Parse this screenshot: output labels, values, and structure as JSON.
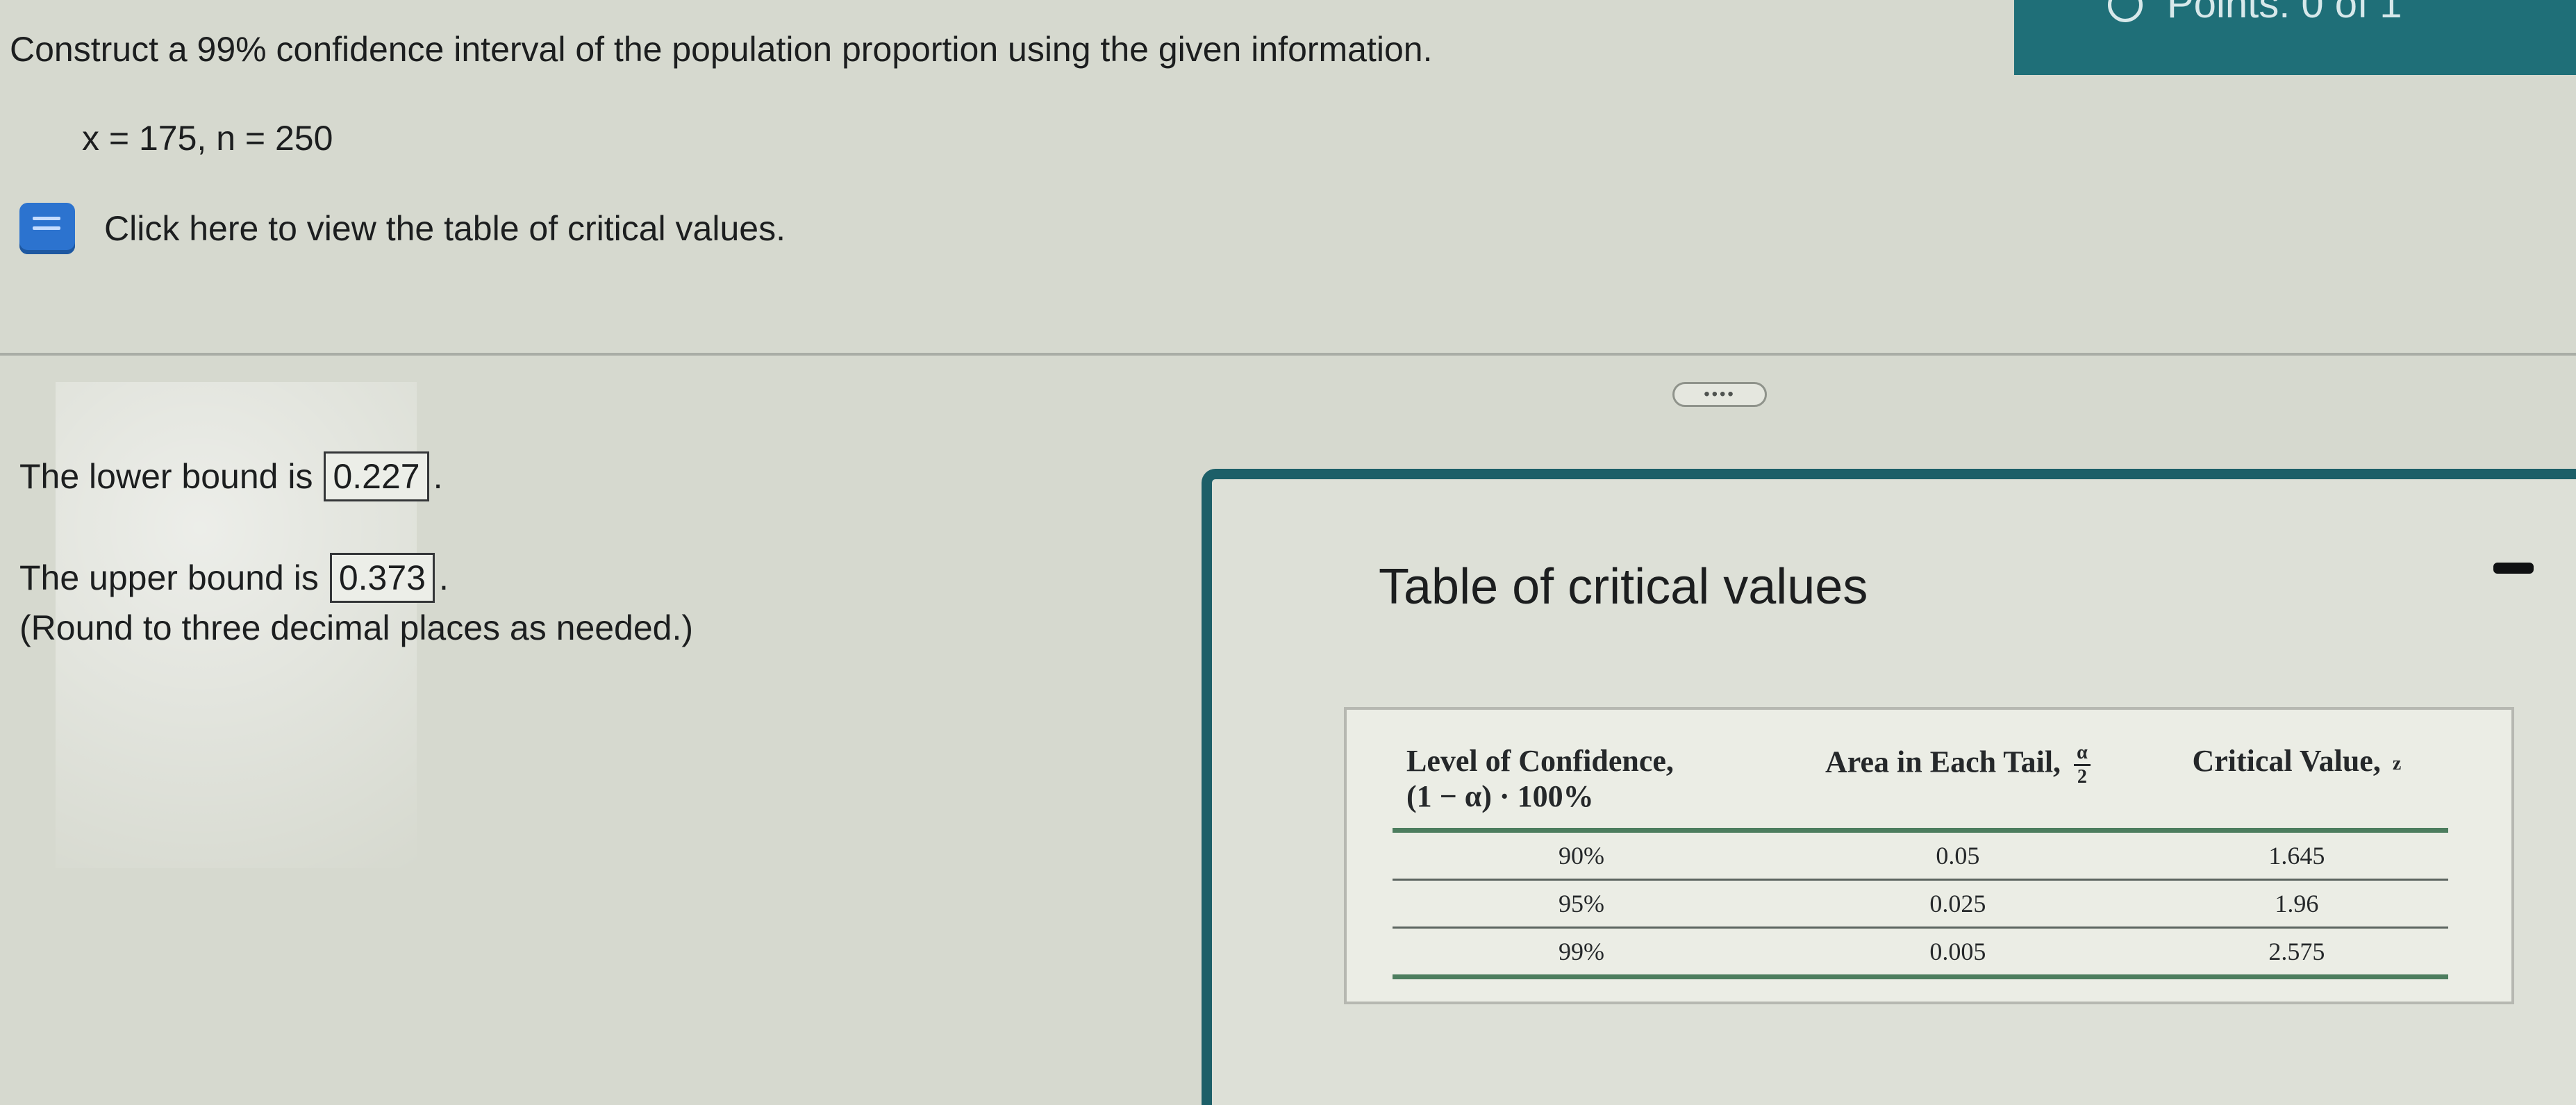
{
  "header": {
    "points_text": "Points: 0 of 1"
  },
  "question": {
    "prompt": "Construct a 99% confidence interval of the population proportion using the given information.",
    "given": "x = 175,  n = 250",
    "reference_link": "Click here to view the table of critical values."
  },
  "answers": {
    "lower_label": "The lower bound is",
    "lower_value": "0.227",
    "upper_label": "The upper bound is",
    "upper_value": "0.373",
    "rounding_note": "(Round to three decimal places as needed.)"
  },
  "popup": {
    "title": "Table of critical values",
    "table": {
      "headers": {
        "col1_line1": "Level of Confidence,",
        "col1_line2": "(1 − α) · 100%",
        "col2": "Area in Each Tail,",
        "col2_frac_num": "α",
        "col2_frac_den": "2",
        "col3": "Critical Value,",
        "col3_sub": "z"
      },
      "rows": [
        {
          "level": "90%",
          "area": "0.05",
          "critical": "1.645"
        },
        {
          "level": "95%",
          "area": "0.025",
          "critical": "1.96"
        },
        {
          "level": "99%",
          "area": "0.005",
          "critical": "2.575"
        }
      ]
    }
  },
  "colors": {
    "page_background": "#d6d9cf",
    "teal_accent": "#1c5f68",
    "book_icon_blue": "#2c73cf",
    "table_rule_green": "#4c7d5e"
  },
  "icons": {
    "reference_icon": "book-icon",
    "status_icon": "circle-icon"
  }
}
